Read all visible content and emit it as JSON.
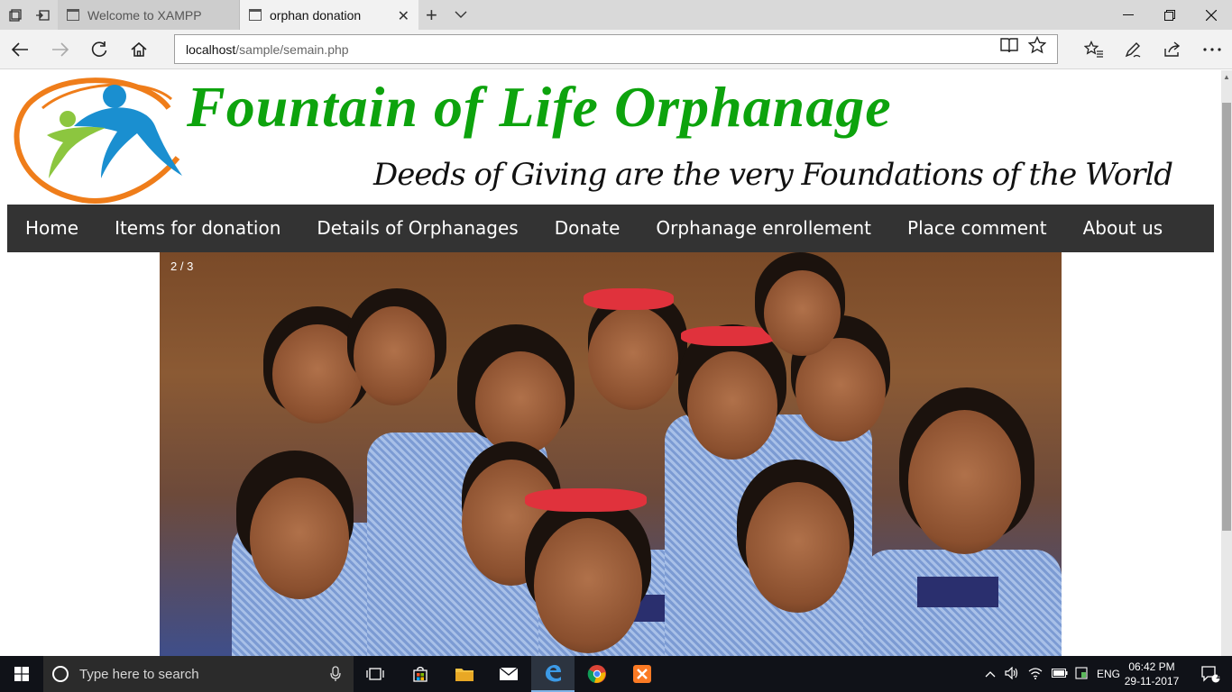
{
  "browser": {
    "tabs": [
      {
        "title": "Welcome to XAMPP",
        "active": false
      },
      {
        "title": "orphan donation",
        "active": true
      }
    ],
    "address": {
      "host": "localhost",
      "path": "/sample/semain.php"
    }
  },
  "site": {
    "title": "Fountain of Life Orphanage",
    "tagline": "Deeds of Giving are the very Foundations of the World",
    "menu": [
      "Home",
      "Items for donation",
      "Details of Orphanages",
      "Donate",
      "Orphanage enrollement",
      "Place comment",
      "About us"
    ],
    "slideshow": {
      "counter": "2 / 3"
    }
  },
  "taskbar": {
    "search_placeholder": "Type here to search",
    "language": "ENG",
    "time": "06:42 PM",
    "date": "29-11-2017",
    "notification_count": "1"
  },
  "colors": {
    "brand_green": "#0da30d",
    "logo_orange": "#ef7d1a",
    "logo_blue": "#1a8fd0",
    "logo_lime": "#8cc63f",
    "menu_bg": "#333333"
  }
}
